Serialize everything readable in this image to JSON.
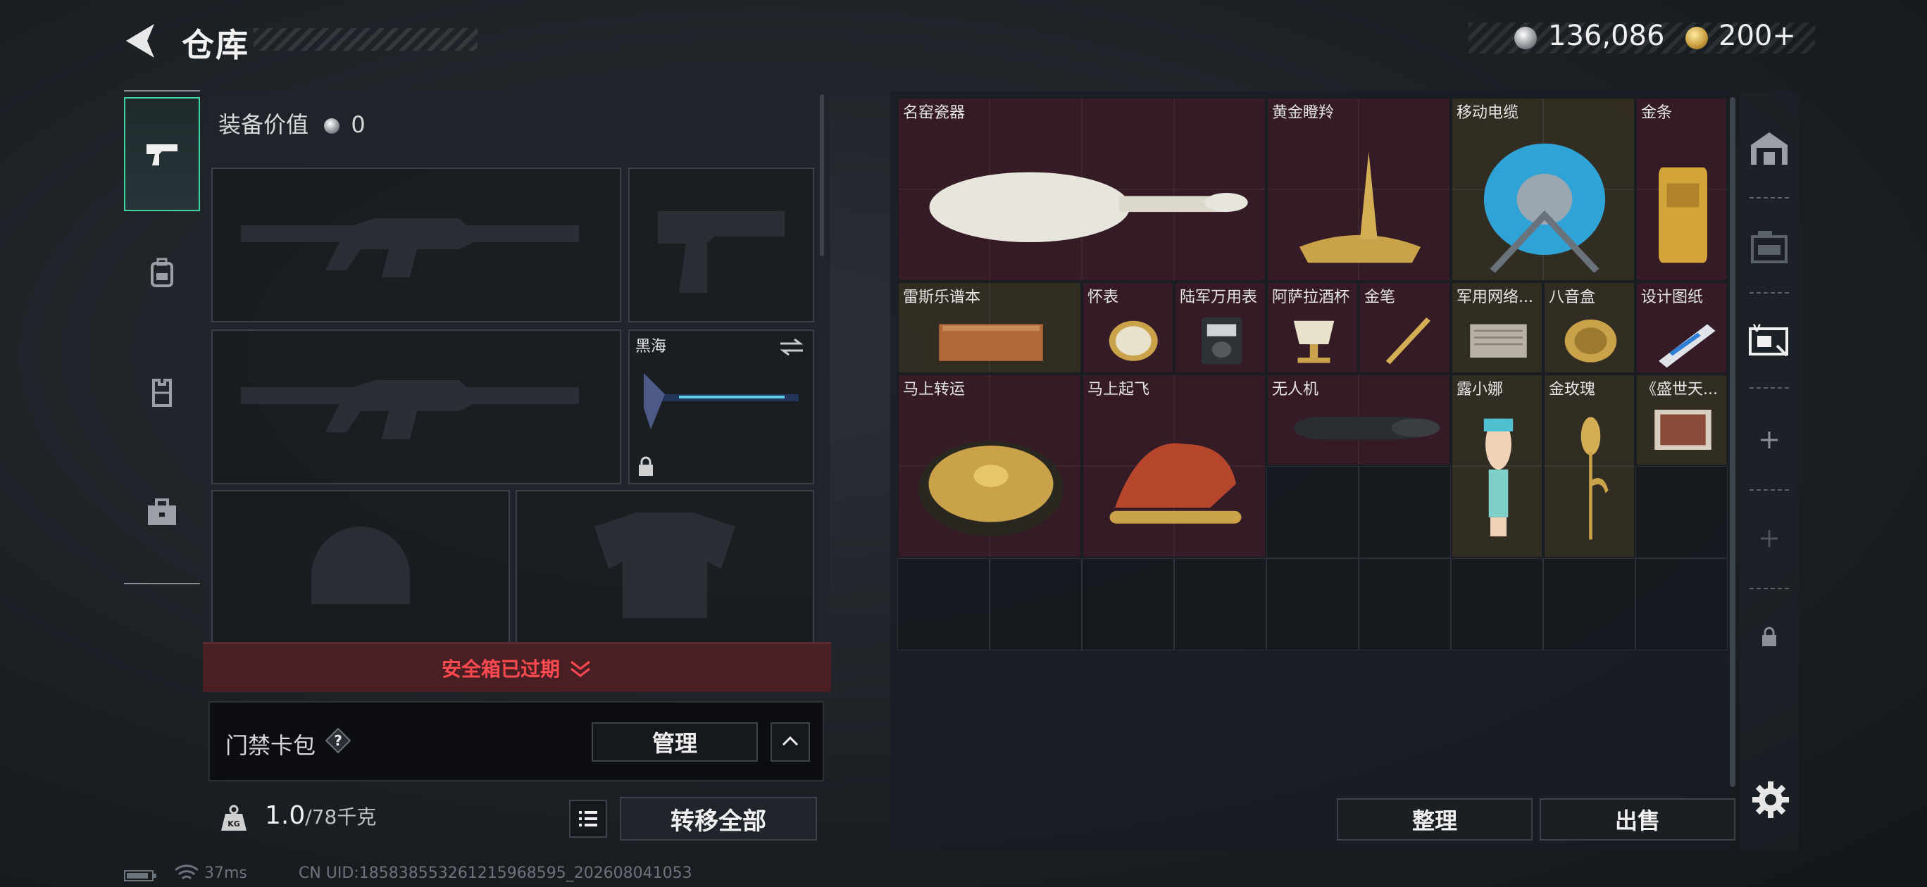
{
  "header": {
    "title": "仓库",
    "silver_amount": "136,086",
    "gold_amount": "200+"
  },
  "equipment": {
    "value_label": "装备价值",
    "value": "0",
    "melee_slot_name": "黑海",
    "safebox_status": "安全箱已过期",
    "keycard_label": "门禁卡包",
    "manage_label": "管理",
    "weight_current": "1.0",
    "weight_max": "/78千克",
    "transfer_all_label": "转移全部"
  },
  "storage": {
    "items": [
      {
        "name": "名窑瓷器",
        "icon": "porcelain-vase-icon",
        "color": "red"
      },
      {
        "name": "黄金瞪羚",
        "icon": "golden-gazelle-icon",
        "color": "red"
      },
      {
        "name": "移动电缆",
        "icon": "cable-reel-icon",
        "color": "gold"
      },
      {
        "name": "金条",
        "icon": "gold-bar-icon",
        "color": "red"
      },
      {
        "name": "雷斯乐谱本",
        "icon": "music-book-icon",
        "color": "gold"
      },
      {
        "name": "怀表",
        "icon": "pocket-watch-icon",
        "color": "red"
      },
      {
        "name": "陆军万用表",
        "icon": "multimeter-icon",
        "color": "red"
      },
      {
        "name": "阿萨拉酒杯",
        "icon": "goblet-icon",
        "color": "red"
      },
      {
        "name": "金笔",
        "icon": "gold-pen-icon",
        "color": "red"
      },
      {
        "name": "军用网络...",
        "icon": "network-module-icon",
        "color": "gold"
      },
      {
        "name": "八音盒",
        "icon": "music-box-icon",
        "color": "gold"
      },
      {
        "name": "设计图纸",
        "icon": "blueprint-icon",
        "color": "red"
      },
      {
        "name": "马上转运",
        "icon": "fortune-wheel-icon",
        "color": "red"
      },
      {
        "name": "马上起飞",
        "icon": "horse-statue-icon",
        "color": "red"
      },
      {
        "name": "无人机",
        "icon": "drone-icon",
        "color": "red"
      },
      {
        "name": "露小娜",
        "icon": "doll-icon",
        "color": "gold"
      },
      {
        "name": "金玫瑰",
        "icon": "gold-rose-icon",
        "color": "gold"
      },
      {
        "name": "《盛世天...",
        "icon": "painting-icon",
        "color": "gold"
      }
    ],
    "sort_label": "整理",
    "sell_label": "出售"
  },
  "status": {
    "ping": "37ms",
    "uid": "CN UID:185838553261215968595_202608041053"
  }
}
